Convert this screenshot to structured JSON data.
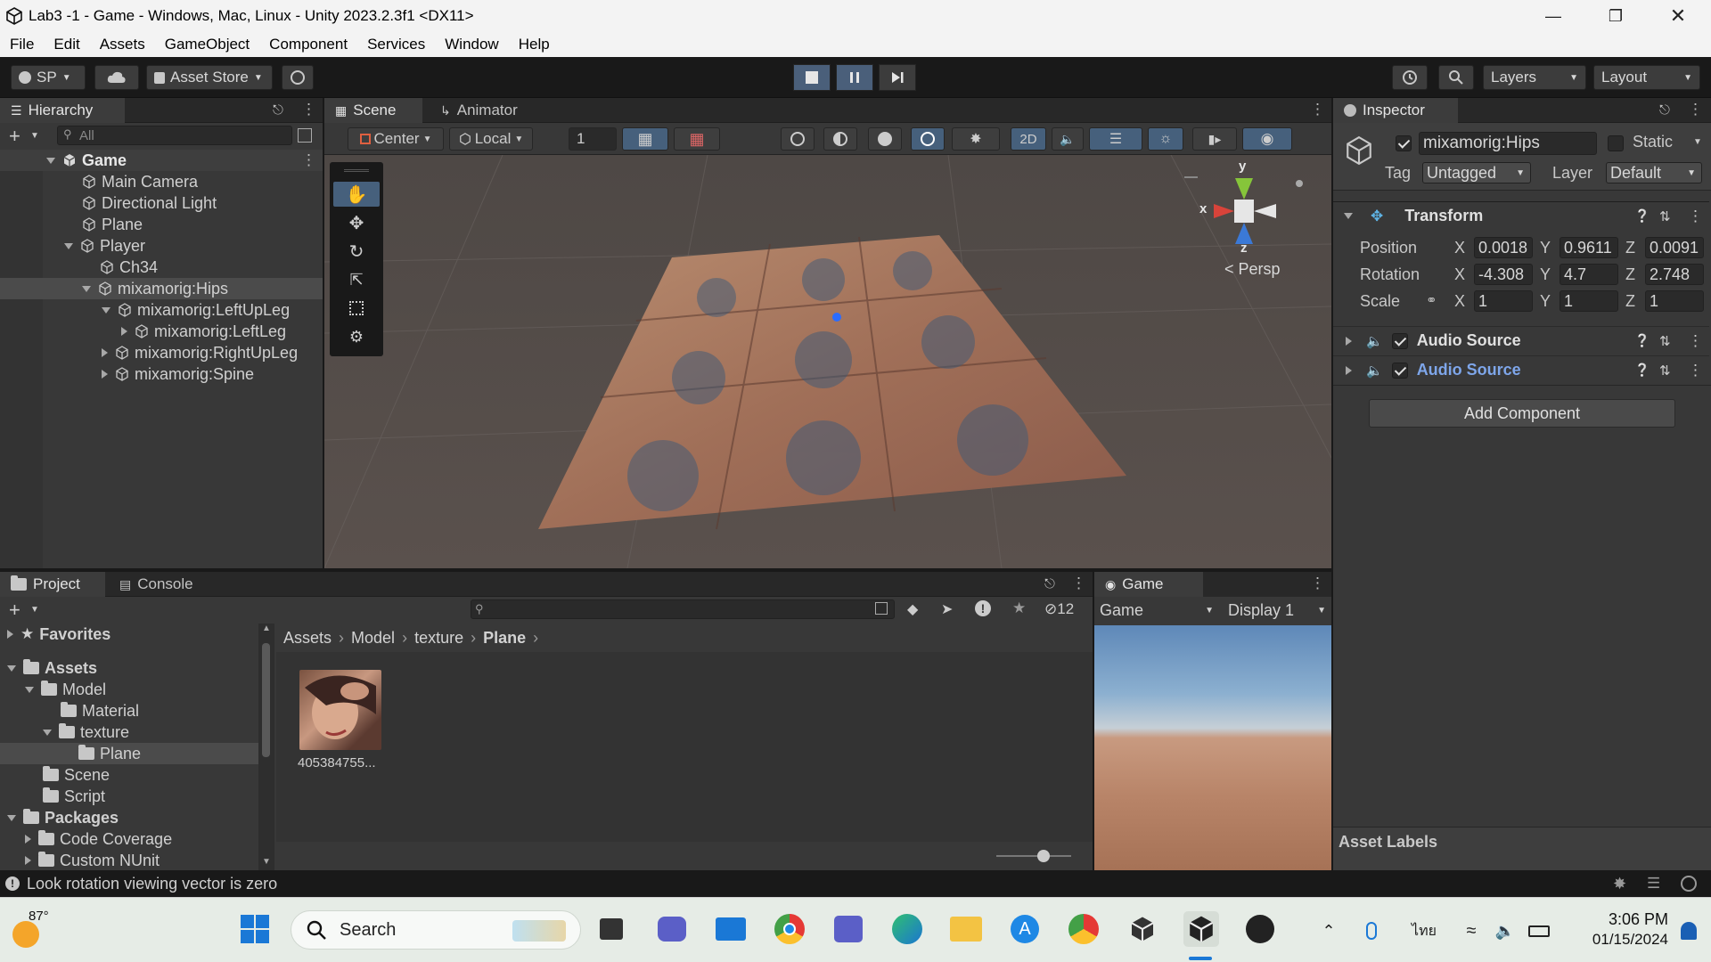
{
  "window": {
    "title": "Lab3 -1 - Game - Windows, Mac, Linux - Unity 2023.2.3f1 <DX11>"
  },
  "menu": [
    "File",
    "Edit",
    "Assets",
    "GameObject",
    "Component",
    "Services",
    "Window",
    "Help"
  ],
  "toolbar": {
    "account": "SP",
    "asset_store": "Asset Store",
    "layers": "Layers",
    "layout": "Layout"
  },
  "hierarchy": {
    "tab": "Hierarchy",
    "search_placeholder": "All",
    "scene": "Game",
    "items": [
      {
        "label": "Main Camera"
      },
      {
        "label": "Directional Light"
      },
      {
        "label": "Plane"
      },
      {
        "label": "Player"
      },
      {
        "label": "Ch34"
      },
      {
        "label": "mixamorig:Hips"
      },
      {
        "label": "mixamorig:LeftUpLeg"
      },
      {
        "label": "mixamorig:LeftLeg"
      },
      {
        "label": "mixamorig:RightUpLeg"
      },
      {
        "label": "mixamorig:Spine"
      }
    ]
  },
  "scene": {
    "tabs": [
      "Scene",
      "Animator"
    ],
    "pivot": "Center",
    "space": "Local",
    "grid_value": "1",
    "mode_2d": "2D",
    "gizmo": {
      "x": "x",
      "y": "y",
      "z": "z",
      "projection": "Persp"
    }
  },
  "inspector": {
    "tab": "Inspector",
    "object_name": "mixamorig:Hips",
    "static": "Static",
    "tag_label": "Tag",
    "tag": "Untagged",
    "layer_label": "Layer",
    "layer": "Default",
    "transform": {
      "title": "Transform",
      "position_label": "Position",
      "rotation_label": "Rotation",
      "scale_label": "Scale",
      "position": {
        "x": "0.0018",
        "y": "0.9611",
        "z": "0.0091"
      },
      "rotation": {
        "x": "-4.308",
        "y": "4.7",
        "z": "2.748"
      },
      "scale": {
        "x": "1",
        "y": "1",
        "z": "1"
      }
    },
    "components": [
      "Audio Source",
      "Audio Source"
    ],
    "add_component": "Add Component",
    "asset_labels": "Asset Labels"
  },
  "project": {
    "tabs": [
      "Project",
      "Console"
    ],
    "hidden_count": "12",
    "favorites": "Favorites",
    "tree": [
      {
        "label": "Assets"
      },
      {
        "label": "Model"
      },
      {
        "label": "Material"
      },
      {
        "label": "texture"
      },
      {
        "label": "Plane"
      },
      {
        "label": "Scene"
      },
      {
        "label": "Script"
      },
      {
        "label": "Packages"
      },
      {
        "label": "Code Coverage"
      },
      {
        "label": "Custom NUnit"
      }
    ],
    "breadcrumb": [
      "Assets",
      "Model",
      "texture",
      "Plane"
    ],
    "asset_name": "405384755..."
  },
  "game": {
    "tab": "Game",
    "view": "Game",
    "display": "Display 1"
  },
  "status": {
    "message": "Look rotation viewing vector is zero"
  },
  "taskbar": {
    "weather": "87°",
    "search": "Search",
    "lang": "ไทย",
    "time": "3:06 PM",
    "date": "01/15/2024"
  }
}
